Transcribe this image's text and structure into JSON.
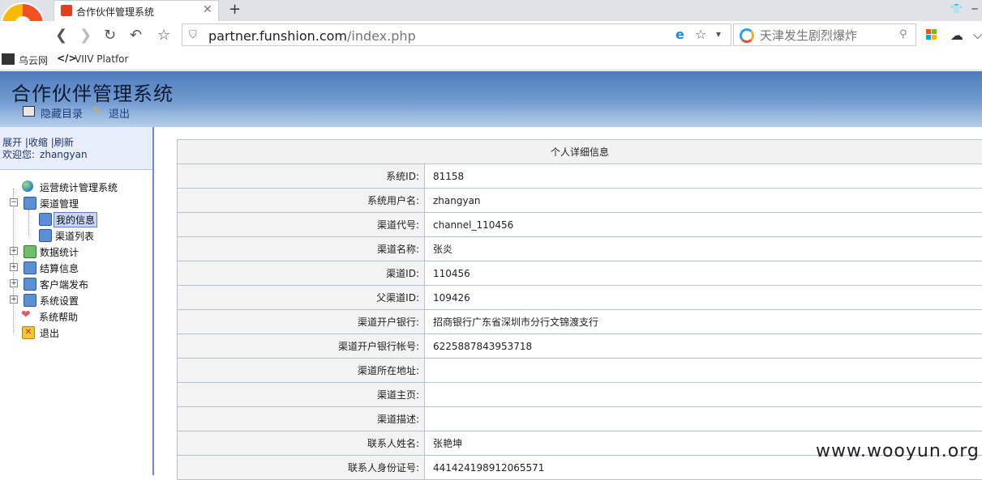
{
  "browser": {
    "tab_title": "合作伙伴管理系统",
    "url_host": "partner.funshion.com",
    "url_path": "/index.php",
    "search_placeholder": "天津发生剧烈爆炸",
    "bookmarks": [
      "乌云网",
      "VIIV Platfor"
    ]
  },
  "header": {
    "title": "合作伙伴管理系统",
    "toc_label": "隐藏目录",
    "exit_label": "退出"
  },
  "sidebar": {
    "actions": [
      "展开",
      "收缩",
      "刷新"
    ],
    "welcome_label": "欢迎您:",
    "username": "zhangyan",
    "tree": [
      {
        "label": "运营统计管理系统"
      },
      {
        "label": "渠道管理"
      },
      {
        "label": "我的信息"
      },
      {
        "label": "渠道列表"
      },
      {
        "label": "数据统计"
      },
      {
        "label": "结算信息"
      },
      {
        "label": "客户端发布"
      },
      {
        "label": "系统设置"
      },
      {
        "label": "系统帮助"
      },
      {
        "label": "退出"
      }
    ]
  },
  "detail": {
    "title": "个人详细信息",
    "rows": [
      {
        "key": "系统ID:",
        "value": "81158"
      },
      {
        "key": "系统用户名:",
        "value": "zhangyan"
      },
      {
        "key": "渠道代号:",
        "value": "channel_110456"
      },
      {
        "key": "渠道名称:",
        "value": "张炎"
      },
      {
        "key": "渠道ID:",
        "value": "110456"
      },
      {
        "key": "父渠道ID:",
        "value": "109426"
      },
      {
        "key": "渠道开户银行:",
        "value": "招商银行广东省深圳市分行文锦渡支行"
      },
      {
        "key": "渠道开户银行帐号:",
        "value": "6225887843953718"
      },
      {
        "key": "渠道所在地址:",
        "value": ""
      },
      {
        "key": "渠道主页:",
        "value": ""
      },
      {
        "key": "渠道描述:",
        "value": ""
      },
      {
        "key": "联系人姓名:",
        "value": "张艳坤"
      },
      {
        "key": "联系人身份证号:",
        "value": "441424198912065571"
      }
    ]
  },
  "watermark": "www.wooyun.org"
}
